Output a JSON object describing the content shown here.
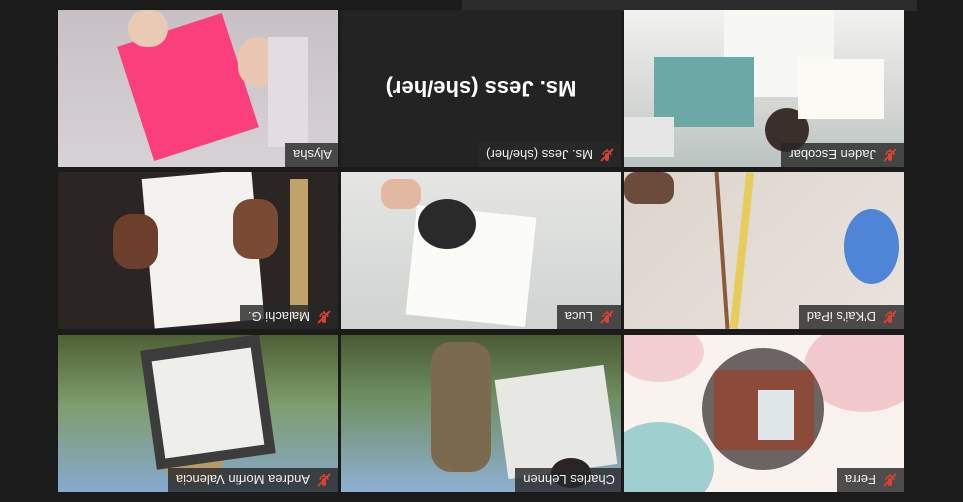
{
  "participants": [
    {
      "name": "Jaden Escobar"
    },
    {
      "name": "Ms. Jess (she/her)"
    },
    {
      "name": "Alysha"
    },
    {
      "name": "D'Kai's iPad"
    },
    {
      "name": "Luca"
    },
    {
      "name": "Malachi G."
    },
    {
      "name": "Ferra"
    },
    {
      "name": "Charles Lehnen"
    },
    {
      "name": "Andrea Morfin Valencia"
    }
  ],
  "center_label": "Ms. Jess (she/her)",
  "colors": {
    "background": "#1b1b1b",
    "active_speaker": "#c6d96a",
    "mic_muted": "#e0412f"
  },
  "icons": {
    "mic": "mic-muted-icon"
  }
}
